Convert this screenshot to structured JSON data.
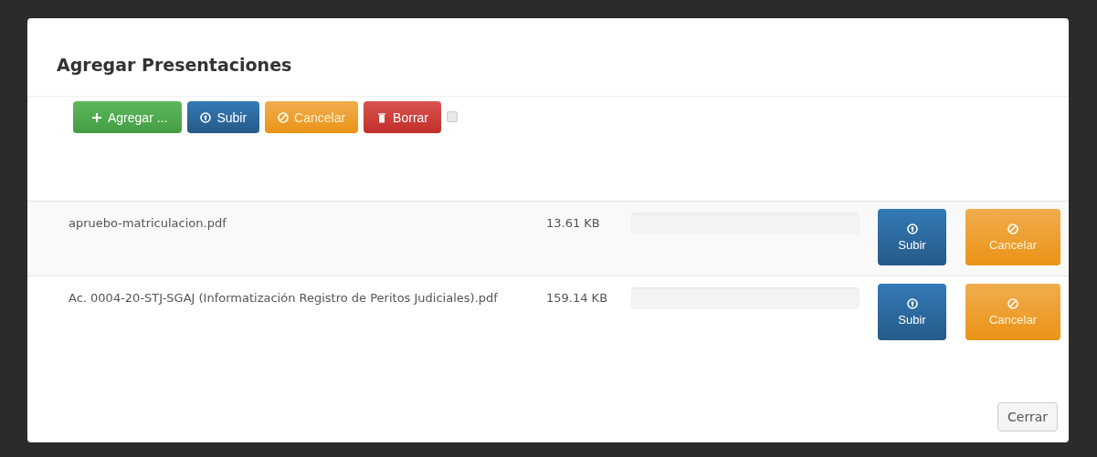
{
  "dialog": {
    "title": "Agregar Presentaciones"
  },
  "toolbar": {
    "buttons": [
      {
        "label": "Agregar ...",
        "kind": "add"
      },
      {
        "label": "Subir",
        "kind": "upload"
      },
      {
        "label": "Cancelar",
        "kind": "cancel"
      },
      {
        "label": "Borrar",
        "kind": "delete"
      }
    ],
    "select_all": {
      "checked": false
    }
  },
  "files": [
    {
      "name": "apruebo-matriculacion.pdf",
      "size": "13.61 KB",
      "level": 0,
      "buttons": [
        {
          "label": "Subir",
          "kind": "upload"
        },
        {
          "label": "Cancelar",
          "kind": "cancel"
        }
      ]
    },
    {
      "name": "Ac. 0004-20-STJ-SGAJ (Informatización Registro de Peritos Judiciales).pdf",
      "size": "159.14 KB",
      "level": 0,
      "buttons": [
        {
          "label": "Subir",
          "kind": "upload"
        },
        {
          "label": "Cancelar",
          "kind": "cancel"
        }
      ]
    }
  ],
  "footer": {
    "close_button": "Cerrar"
  }
}
